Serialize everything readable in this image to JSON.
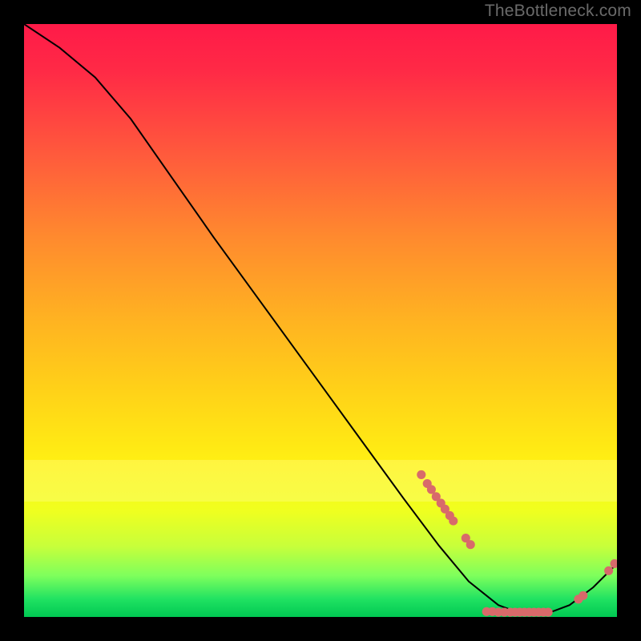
{
  "watermark": "TheBottleneck.com",
  "colors": {
    "page_bg": "#000000",
    "watermark": "#6a6a6a",
    "curve": "#000000",
    "dot": "#d86a6a"
  },
  "chart_data": {
    "type": "line",
    "title": "",
    "xlabel": "",
    "ylabel": "",
    "xlim": [
      0,
      100
    ],
    "ylim": [
      0,
      100
    ],
    "grid": false,
    "legend": false,
    "curve": [
      {
        "x": 0,
        "y": 100
      },
      {
        "x": 6,
        "y": 96
      },
      {
        "x": 12,
        "y": 91
      },
      {
        "x": 18,
        "y": 84
      },
      {
        "x": 25,
        "y": 74
      },
      {
        "x": 32,
        "y": 64
      },
      {
        "x": 40,
        "y": 53
      },
      {
        "x": 48,
        "y": 42
      },
      {
        "x": 56,
        "y": 31
      },
      {
        "x": 64,
        "y": 20
      },
      {
        "x": 70,
        "y": 12
      },
      {
        "x": 75,
        "y": 6
      },
      {
        "x": 80,
        "y": 2
      },
      {
        "x": 84,
        "y": 0.5
      },
      {
        "x": 88,
        "y": 0.5
      },
      {
        "x": 92,
        "y": 2
      },
      {
        "x": 96,
        "y": 5
      },
      {
        "x": 100,
        "y": 9
      }
    ],
    "dots_upper_cluster": [
      {
        "x": 67,
        "y": 24
      },
      {
        "x": 68,
        "y": 22.5
      },
      {
        "x": 68.7,
        "y": 21.5
      },
      {
        "x": 69.5,
        "y": 20.3
      },
      {
        "x": 70.3,
        "y": 19.2
      },
      {
        "x": 71,
        "y": 18.2
      },
      {
        "x": 71.8,
        "y": 17.1
      },
      {
        "x": 72.4,
        "y": 16.2
      },
      {
        "x": 74.5,
        "y": 13.3
      },
      {
        "x": 75.3,
        "y": 12.2
      }
    ],
    "dots_bottom_cluster": [
      {
        "x": 78.0,
        "y": 0.9
      },
      {
        "x": 79.0,
        "y": 0.9
      },
      {
        "x": 80.0,
        "y": 0.8
      },
      {
        "x": 81.0,
        "y": 0.8
      },
      {
        "x": 82.0,
        "y": 0.8
      },
      {
        "x": 82.8,
        "y": 0.8
      },
      {
        "x": 83.6,
        "y": 0.8
      },
      {
        "x": 84.4,
        "y": 0.8
      },
      {
        "x": 85.2,
        "y": 0.8
      },
      {
        "x": 86.0,
        "y": 0.8
      },
      {
        "x": 86.8,
        "y": 0.8
      },
      {
        "x": 87.6,
        "y": 0.8
      },
      {
        "x": 88.4,
        "y": 0.8
      }
    ],
    "dots_right_cluster": [
      {
        "x": 93.5,
        "y": 3.0
      },
      {
        "x": 94.3,
        "y": 3.6
      },
      {
        "x": 98.6,
        "y": 7.8
      },
      {
        "x": 99.6,
        "y": 9.0
      }
    ]
  }
}
